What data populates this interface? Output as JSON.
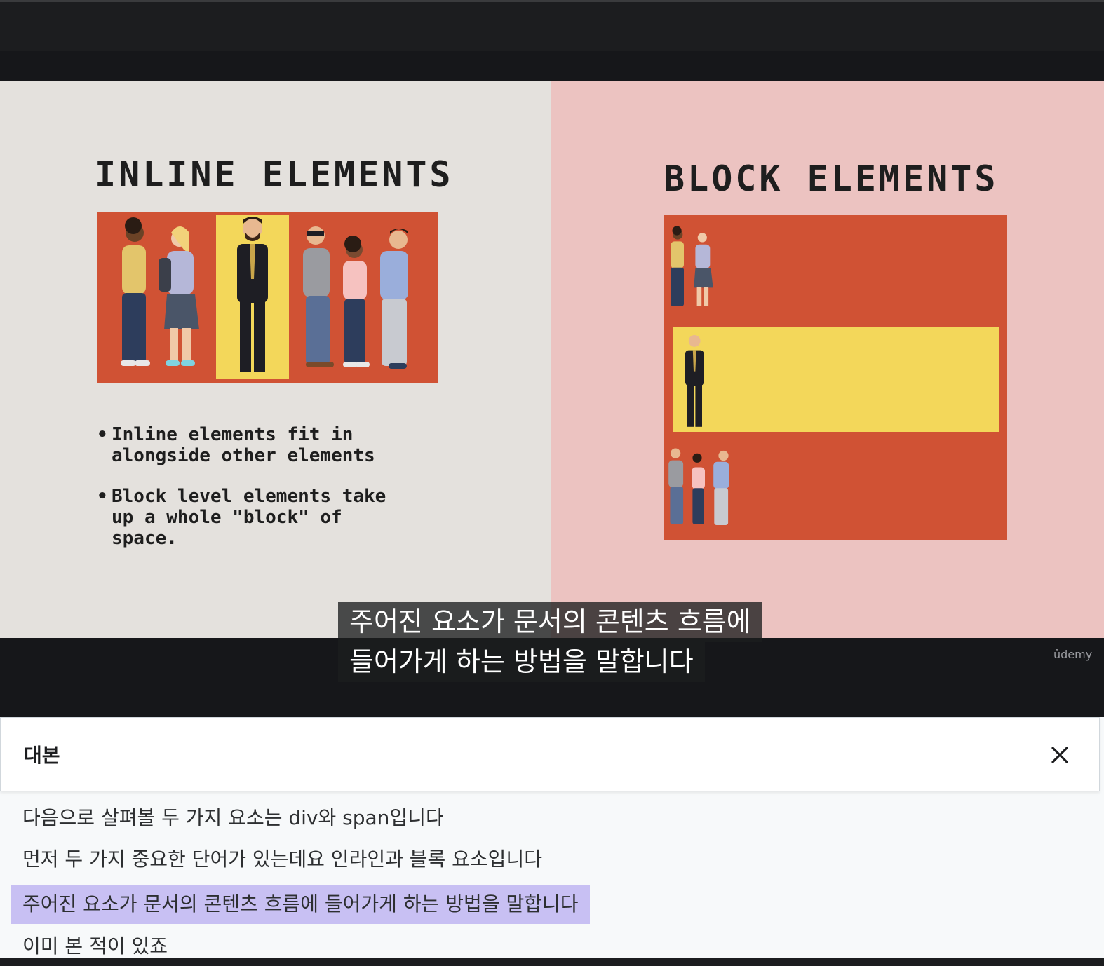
{
  "slide": {
    "inline_heading": "INLINE ELEMENTS",
    "block_heading": "BLOCK ELEMENTS",
    "bullets": [
      "Inline elements fit in\nalongside other elements",
      "Block level elements take\nup a whole \"block\" of\nspace."
    ]
  },
  "subtitle": {
    "line1": "주어진 요소가 문서의 콘텐츠 흐름에",
    "line2": "들어가게 하는 방법을 말합니다"
  },
  "watermark": "ûdemy",
  "transcript": {
    "title": "대본",
    "cues": [
      "다음으로 살펴볼 두 가지 요소는 div와 span입니다",
      "먼저 두 가지 중요한 단어가 있는데요 인라인과 블록 요소입니다",
      "주어진 요소가 문서의 콘텐츠 흐름에 들어가게 하는 방법을 말합니다",
      "이미 본 적이 있죠"
    ],
    "active_index": 2
  },
  "colors": {
    "slide_left_bg": "#e4e1dd",
    "slide_right_bg": "#ecc3c1",
    "illustration_bg": "#d05234",
    "highlight_yellow": "#f3d75a",
    "active_cue_bg": "#c8c0f3"
  },
  "icons": {
    "close": "close-icon"
  }
}
